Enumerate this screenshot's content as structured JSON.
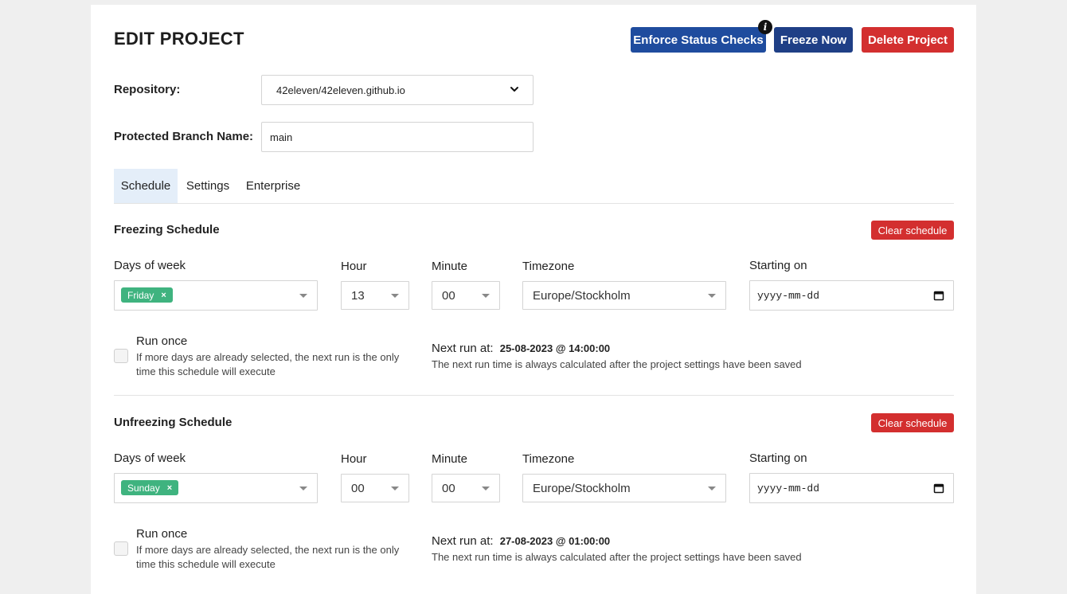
{
  "header": {
    "title": "EDIT PROJECT",
    "enforce_label": "Enforce Status Checks",
    "freeze_label": "Freeze Now",
    "delete_label": "Delete Project",
    "info_glyph": "i"
  },
  "form": {
    "repository_label": "Repository:",
    "repository_value": "42eleven/42eleven.github.io",
    "branch_label": "Protected Branch Name:",
    "branch_value": "main"
  },
  "tabs": [
    {
      "label": "Schedule",
      "active": true
    },
    {
      "label": "Settings",
      "active": false
    },
    {
      "label": "Enterprise",
      "active": false
    }
  ],
  "freezing": {
    "title": "Freezing Schedule",
    "clear_label": "Clear schedule",
    "days_label": "Days of week",
    "days": [
      "Friday"
    ],
    "hour_label": "Hour",
    "hour": "13",
    "minute_label": "Minute",
    "minute": "00",
    "timezone_label": "Timezone",
    "timezone": "Europe/Stockholm",
    "starting_label": "Starting on",
    "starting_value": "yyyy-mm-dd",
    "run_once_label": "Run once",
    "run_once_help": "If more days are already selected, the next run is the only time this schedule will execute",
    "next_run_label": "Next run at:",
    "next_run_value": "25-08-2023 @ 14:00:00",
    "next_run_help": "The next run time is always calculated after the project settings have been saved"
  },
  "unfreezing": {
    "title": "Unfreezing Schedule",
    "clear_label": "Clear schedule",
    "days_label": "Days of week",
    "days": [
      "Sunday"
    ],
    "hour_label": "Hour",
    "hour": "00",
    "minute_label": "Minute",
    "minute": "00",
    "timezone_label": "Timezone",
    "timezone": "Europe/Stockholm",
    "starting_label": "Starting on",
    "starting_value": "yyyy-mm-dd",
    "run_once_label": "Run once",
    "run_once_help": "If more days are already selected, the next run is the only time this schedule will execute",
    "next_run_label": "Next run at:",
    "next_run_value": "27-08-2023 @ 01:00:00",
    "next_run_help": "The next run time is always calculated after the project settings have been saved"
  },
  "colors": {
    "primary": "#1f4c9e",
    "primary_dark": "#1f3f86",
    "danger": "#d32f2f",
    "tag": "#3fb37f",
    "active_tab": "#e4eef9"
  },
  "icons": {
    "info": "info-icon",
    "chevron": "chevron-down-icon",
    "calendar": "calendar-icon",
    "tag_remove": "close-icon"
  }
}
